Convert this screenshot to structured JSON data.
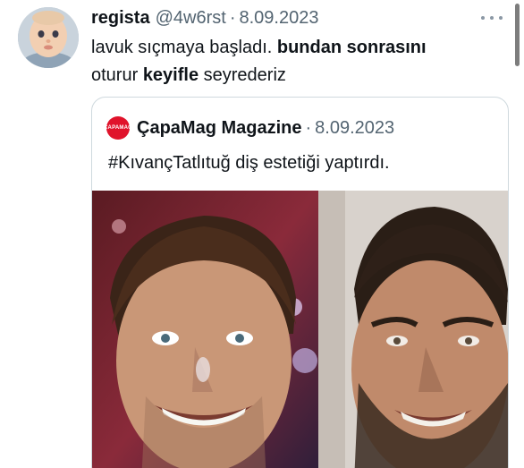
{
  "tweet": {
    "author_name": "regista",
    "author_handle": "@4w6rst",
    "separator": "·",
    "date": "8.09.2023",
    "text_line1_a": "lavuk sıçmaya başladı. ",
    "text_line1_b": "bundan sonrasını",
    "text_line2_a": "oturur ",
    "text_line2_b": "keyifle",
    "text_line2_c": " seyrederiz",
    "more_icon": "ellipsis-icon"
  },
  "quoted": {
    "logo_text": "ÇAPAMAG",
    "author_name": "ÇapaMag Magazine",
    "separator": "·",
    "date": "8.09.2023",
    "text": "#KıvançTatlıtuğ diş estetiği yaptırdı."
  },
  "colors": {
    "secondary_text": "#536471",
    "border": "#cfd9de",
    "logo_red": "#e0132b"
  }
}
